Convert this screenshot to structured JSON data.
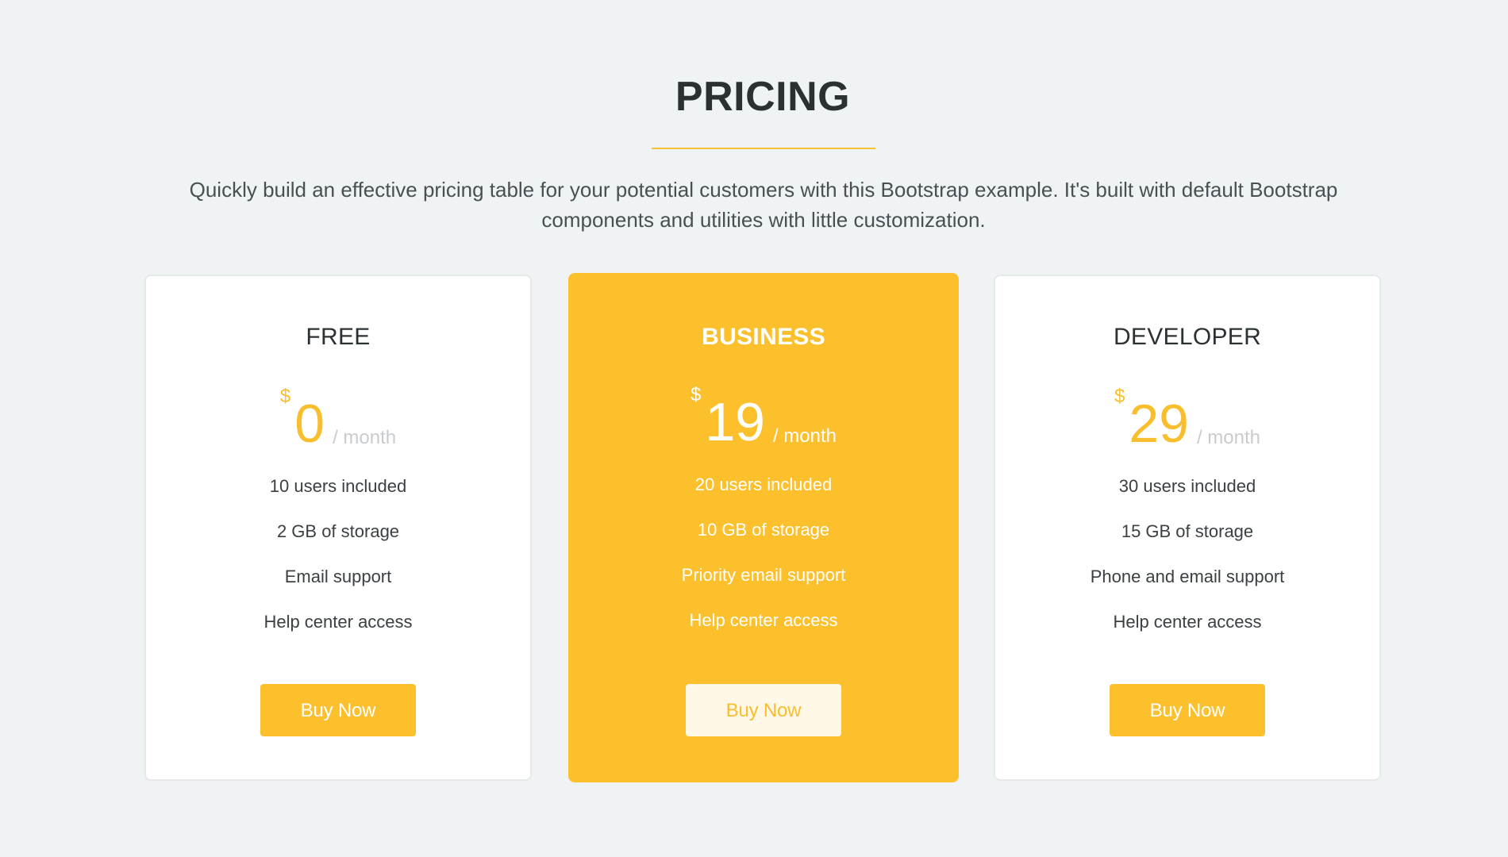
{
  "header": {
    "title": "PRICING",
    "intro": "Quickly build an effective pricing table for your potential customers with this Bootstrap example. It's built with default Bootstrap components and utilities with little customization."
  },
  "colors": {
    "accent": "#fdc02d",
    "background": "#f0f3f4",
    "card": "#ffffff",
    "text": "#2c3234"
  },
  "plans": [
    {
      "title": "FREE",
      "currency": "$",
      "price": "0",
      "period": "/ month",
      "features": [
        "10 users included",
        "2 GB of storage",
        "Email support",
        "Help center access"
      ],
      "button": "Buy Now",
      "featured": false
    },
    {
      "title": "BUSINESS",
      "currency": "$",
      "price": "19",
      "period": "/ month",
      "features": [
        "20 users included",
        "10 GB of storage",
        "Priority email support",
        "Help center access"
      ],
      "button": "Buy Now",
      "featured": true
    },
    {
      "title": "DEVELOPER",
      "currency": "$",
      "price": "29",
      "period": "/ month",
      "features": [
        "30 users included",
        "15 GB of storage",
        "Phone and email support",
        "Help center access"
      ],
      "button": "Buy Now",
      "featured": false
    }
  ]
}
